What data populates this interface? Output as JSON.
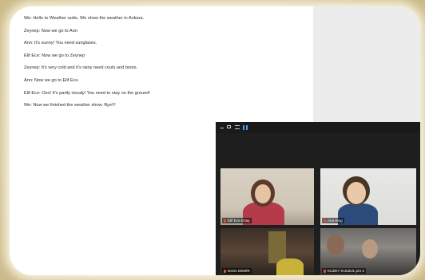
{
  "document": {
    "lines": [
      "We: Hello to Weather radio. We show the weather in Ankara.",
      "Zeynep: Now we go to Ann",
      "Ann: It's sunny! You need sunglases.",
      "Elif Ece: Now we go to Zeynep",
      "Zeynep: It's very cold and it's rainy need couts and boots.",
      "Ann: Now we go to Elif Ece.",
      "Elif Ece: Ooo! It's partly cloudy! You need to stay on the ground!",
      "We: Now we finished the weather show. Bye!!!"
    ]
  },
  "video_call": {
    "toolbar_icons": [
      "minimize-icon",
      "window-icon",
      "list-icon",
      "gallery-view-icon"
    ],
    "participants": [
      {
        "name": "Elif Ece Ertaş"
      },
      {
        "name": "Ann King"
      },
      {
        "name": "Deniz DEMİR"
      },
      {
        "name": "KUZEY KULBUL pro 2"
      }
    ]
  },
  "colors": {
    "accent": "#4aa3ff",
    "mic_muted": "#e74c3c"
  }
}
